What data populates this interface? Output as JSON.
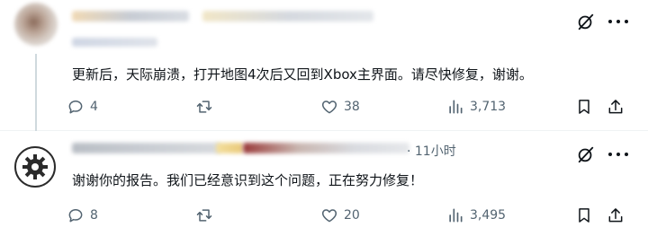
{
  "tweets": [
    {
      "text": "更新后，天际崩溃，打开地图4次后又回到Xbox主界面。请尽快修复，谢谢。",
      "replies": "4",
      "retweets": "",
      "likes": "38",
      "views": "3,713"
    },
    {
      "time": "· 11小时",
      "text": "谢谢你的报告。我们已经意识到这个问题，正在努力修复！",
      "replies": "8",
      "retweets": "",
      "likes": "20",
      "views": "3,495"
    }
  ],
  "icons": {
    "grok": "grok-icon",
    "more": "more-icon",
    "reply": "reply-icon",
    "retweet": "retweet-icon",
    "like": "heart-icon",
    "views": "views-icon",
    "bookmark": "bookmark-icon",
    "share": "share-icon",
    "avatar2": "gear-icon"
  },
  "colors": {
    "text": "#0f1419",
    "muted": "#536471",
    "divider": "#eff3f4",
    "thread": "#cfd9de"
  }
}
